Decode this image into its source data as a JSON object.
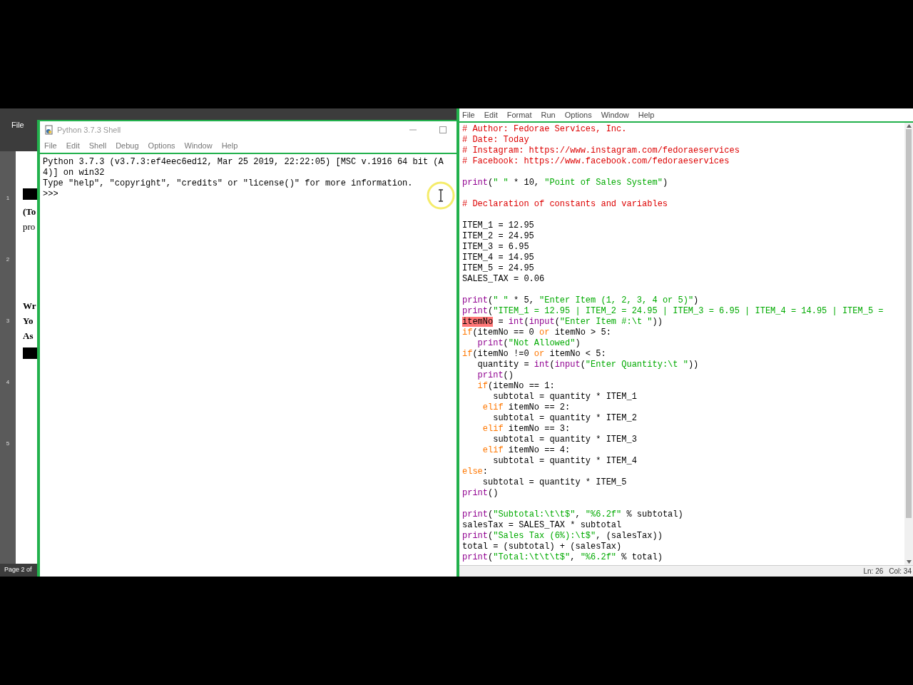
{
  "document_window": {
    "menu": "File",
    "text_fragments": [
      {
        "kind": "block"
      },
      {
        "kind": "text",
        "text": "(To",
        "bold": true
      },
      {
        "kind": "text",
        "text": "pro",
        "bold": false
      },
      {
        "kind": "space"
      },
      {
        "kind": "text",
        "text": "Wr",
        "bold": true
      },
      {
        "kind": "text",
        "text": "Yo",
        "bold": true
      },
      {
        "kind": "text",
        "text": "As",
        "bold": true
      },
      {
        "kind": "block"
      }
    ],
    "ruler_numbers": [
      "1",
      "2",
      "3",
      "4",
      "5"
    ],
    "status": "Page 2 of"
  },
  "shell_window": {
    "title": "Python 3.7.3 Shell",
    "menu": [
      "File",
      "Edit",
      "Shell",
      "Debug",
      "Options",
      "Window",
      "Help"
    ],
    "lines": [
      "Python 3.7.3 (v3.7.3:ef4eec6ed12, Mar 25 2019, 22:22:05) [MSC v.1916 64 bit (A",
      "4)] on win32",
      "Type \"help\", \"copyright\", \"credits\" or \"license()\" for more information.",
      ">>>"
    ]
  },
  "editor_window": {
    "menu": [
      "File",
      "Edit",
      "Format",
      "Run",
      "Options",
      "Window",
      "Help"
    ],
    "code_blocks": [
      {
        "lines": [
          [
            {
              "kind": "comment",
              "text": "# Author: Fedorae Services, Inc."
            }
          ],
          [
            {
              "kind": "comment",
              "text": "# Date: Today"
            }
          ],
          [
            {
              "kind": "comment",
              "text": "# Instagram: https://www.instagram.com/fedoraeservices"
            }
          ],
          [
            {
              "kind": "comment",
              "text": "# Facebook: https://www.facebook.com/fedoraeservices"
            }
          ]
        ]
      },
      {
        "lines": [
          [
            {
              "kind": "builtin",
              "text": "print"
            },
            {
              "kind": "plain",
              "text": "("
            },
            {
              "kind": "string",
              "text": "\" \""
            },
            {
              "kind": "plain",
              "text": " * 10, "
            },
            {
              "kind": "string",
              "text": "\"Point of Sales System\""
            },
            {
              "kind": "plain",
              "text": ")"
            }
          ]
        ]
      },
      {
        "lines": [
          [
            {
              "kind": "comment",
              "text": "# Declaration of constants and variables"
            }
          ]
        ]
      },
      {
        "lines": [
          [
            {
              "kind": "plain",
              "text": "ITEM_1 = 12.95"
            }
          ],
          [
            {
              "kind": "plain",
              "text": "ITEM_2 = 24.95"
            }
          ],
          [
            {
              "kind": "plain",
              "text": "ITEM_3 = 6.95"
            }
          ],
          [
            {
              "kind": "plain",
              "text": "ITEM_4 = 14.95"
            }
          ],
          [
            {
              "kind": "plain",
              "text": "ITEM_5 = 24.95"
            }
          ],
          [
            {
              "kind": "plain",
              "text": "SALES_TAX = 0.06"
            }
          ]
        ]
      },
      {
        "lines": [
          [
            {
              "kind": "builtin",
              "text": "print"
            },
            {
              "kind": "plain",
              "text": "("
            },
            {
              "kind": "string",
              "text": "\" \""
            },
            {
              "kind": "plain",
              "text": " * 5, "
            },
            {
              "kind": "string",
              "text": "\"Enter Item (1, 2, 3, 4 or 5)\""
            },
            {
              "kind": "plain",
              "text": ")"
            }
          ],
          [
            {
              "kind": "builtin",
              "text": "print"
            },
            {
              "kind": "plain",
              "text": "("
            },
            {
              "kind": "string",
              "text": "\"ITEM_1 = 12.95 | ITEM_2 = 24.95 | ITEM_3 = 6.95 | ITEM_4 = 14.95 | ITEM_5 ="
            }
          ],
          [
            {
              "kind": "error",
              "text": "itemNo"
            },
            {
              "kind": "plain",
              "text": " = "
            },
            {
              "kind": "builtin",
              "text": "int"
            },
            {
              "kind": "plain",
              "text": "("
            },
            {
              "kind": "builtin",
              "text": "input"
            },
            {
              "kind": "plain",
              "text": "("
            },
            {
              "kind": "string",
              "text": "\"Enter Item #:\\t \""
            },
            {
              "kind": "plain",
              "text": "))"
            }
          ],
          [
            {
              "kind": "keyword",
              "text": "if"
            },
            {
              "kind": "plain",
              "text": "(itemNo == 0 "
            },
            {
              "kind": "keyword",
              "text": "or"
            },
            {
              "kind": "plain",
              "text": " itemNo > 5:"
            }
          ],
          [
            {
              "kind": "builtin",
              "text": "   print"
            },
            {
              "kind": "plain",
              "text": "("
            },
            {
              "kind": "string",
              "text": "\"Not Allowed\""
            },
            {
              "kind": "plain",
              "text": ")"
            }
          ],
          [
            {
              "kind": "keyword",
              "text": "if"
            },
            {
              "kind": "plain",
              "text": "(itemNo !=0 "
            },
            {
              "kind": "keyword",
              "text": "or"
            },
            {
              "kind": "plain",
              "text": " itemNo < 5:"
            }
          ],
          [
            {
              "kind": "plain",
              "text": "   quantity = "
            },
            {
              "kind": "builtin",
              "text": "int"
            },
            {
              "kind": "plain",
              "text": "("
            },
            {
              "kind": "builtin",
              "text": "input"
            },
            {
              "kind": "plain",
              "text": "("
            },
            {
              "kind": "string",
              "text": "\"Enter Quantity:\\t \""
            },
            {
              "kind": "plain",
              "text": "))"
            }
          ],
          [
            {
              "kind": "builtin",
              "text": "   print"
            },
            {
              "kind": "plain",
              "text": "()"
            }
          ],
          [
            {
              "kind": "keyword",
              "text": "   if"
            },
            {
              "kind": "plain",
              "text": "(itemNo == 1:"
            }
          ],
          [
            {
              "kind": "plain",
              "text": "      subtotal = quantity * ITEM_1"
            }
          ],
          [
            {
              "kind": "keyword",
              "text": "    elif"
            },
            {
              "kind": "plain",
              "text": " itemNo == 2:"
            }
          ],
          [
            {
              "kind": "plain",
              "text": "      subtotal = quantity * ITEM_2"
            }
          ],
          [
            {
              "kind": "keyword",
              "text": "    elif"
            },
            {
              "kind": "plain",
              "text": " itemNo == 3:"
            }
          ],
          [
            {
              "kind": "plain",
              "text": "      subtotal = quantity * ITEM_3"
            }
          ],
          [
            {
              "kind": "keyword",
              "text": "    elif"
            },
            {
              "kind": "plain",
              "text": " itemNo == 4:"
            }
          ],
          [
            {
              "kind": "plain",
              "text": "      subtotal = quantity * ITEM_4"
            }
          ],
          [
            {
              "kind": "keyword",
              "text": "else"
            },
            {
              "kind": "plain",
              "text": ":"
            }
          ],
          [
            {
              "kind": "plain",
              "text": "    subtotal = quantity * ITEM_5"
            }
          ],
          [
            {
              "kind": "builtin",
              "text": "print"
            },
            {
              "kind": "plain",
              "text": "()"
            }
          ]
        ]
      },
      {
        "lines": [
          [
            {
              "kind": "builtin",
              "text": "print"
            },
            {
              "kind": "plain",
              "text": "("
            },
            {
              "kind": "string",
              "text": "\"Subtotal:\\t\\t$\""
            },
            {
              "kind": "plain",
              "text": ", "
            },
            {
              "kind": "string",
              "text": "\"%6.2f\""
            },
            {
              "kind": "plain",
              "text": " % subtotal)"
            }
          ],
          [
            {
              "kind": "plain",
              "text": "salesTax = SALES_TAX * subtotal"
            }
          ],
          [
            {
              "kind": "builtin",
              "text": "print"
            },
            {
              "kind": "plain",
              "text": "("
            },
            {
              "kind": "string",
              "text": "\"Sales Tax (6%):\\t$\""
            },
            {
              "kind": "plain",
              "text": ", (salesTax))"
            }
          ],
          [
            {
              "kind": "plain",
              "text": "total = (subtotal) + (salesTax)"
            }
          ],
          [
            {
              "kind": "builtin",
              "text": "print"
            },
            {
              "kind": "plain",
              "text": "("
            },
            {
              "kind": "string",
              "text": "\"Total:\\t\\t\\t$\""
            },
            {
              "kind": "plain",
              "text": ", "
            },
            {
              "kind": "string",
              "text": "\"%6.2f\""
            },
            {
              "kind": "plain",
              "text": " % total)"
            }
          ]
        ]
      }
    ],
    "status": [
      "Ln: 26",
      "Col: 34"
    ]
  }
}
